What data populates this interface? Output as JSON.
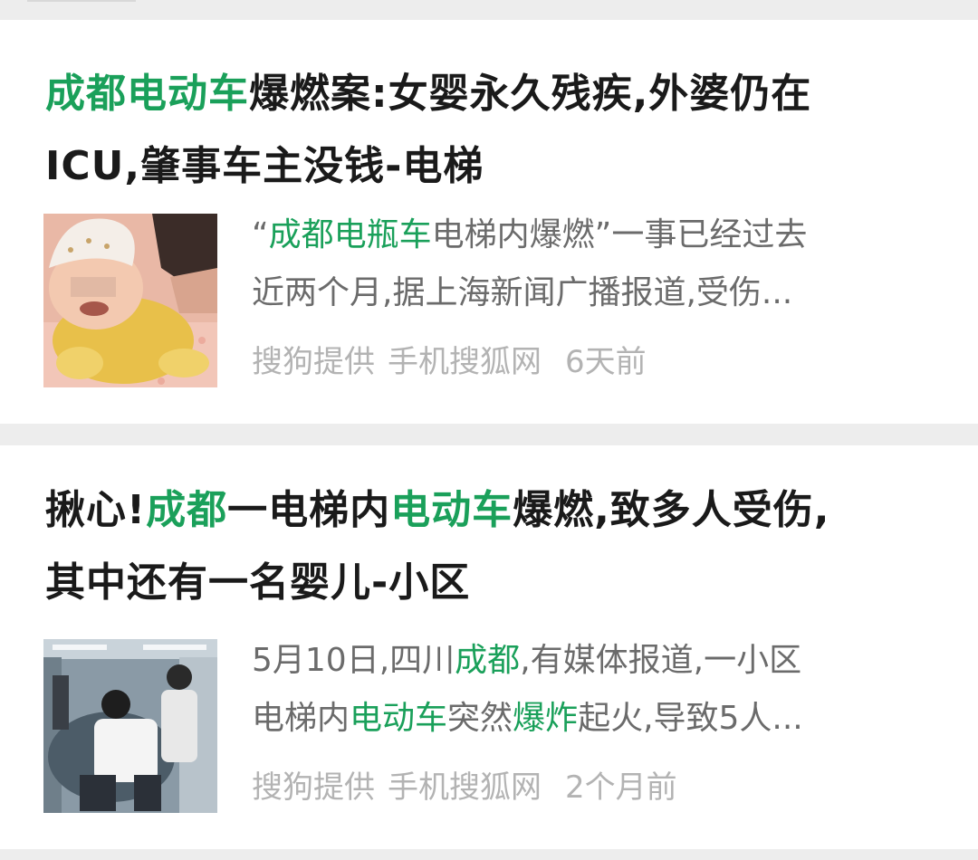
{
  "results": [
    {
      "title_parts": [
        {
          "text": "成都电动车",
          "hl": true
        },
        {
          "text": "爆燃案:女婴永久残疾,外婆仍在",
          "hl": false
        }
      ],
      "title_line2": "ICU,肇事车主没钱-电梯",
      "snippet_line1_parts": [
        {
          "text": "“",
          "hl": false
        },
        {
          "text": "成都电瓶车",
          "hl": true
        },
        {
          "text": "电梯内爆燃”一事已经过去",
          "hl": false
        }
      ],
      "snippet_line2": "近两个月,据上海新闻广播报道,受伤...",
      "provider": "搜狗提供",
      "source": "手机搜狐网",
      "time": "6天前",
      "thumb_icon": "baby-photo-thumbnail"
    },
    {
      "title_parts": [
        {
          "text": "揪心!",
          "hl": false
        },
        {
          "text": "成都",
          "hl": true
        },
        {
          "text": "一电梯内",
          "hl": false
        },
        {
          "text": "电动车",
          "hl": true
        },
        {
          "text": "爆燃,致多人受伤,",
          "hl": false
        }
      ],
      "title_line2": "其中还有一名婴儿-小区",
      "snippet_line1_parts": [
        {
          "text": "5月10日,四川",
          "hl": false
        },
        {
          "text": "成都",
          "hl": true
        },
        {
          "text": ",有媒体报道,一小区",
          "hl": false
        }
      ],
      "snippet_line2_parts": [
        {
          "text": "电梯内",
          "hl": false
        },
        {
          "text": "电动车",
          "hl": true
        },
        {
          "text": "突然",
          "hl": false
        },
        {
          "text": "爆炸",
          "hl": true
        },
        {
          "text": "起火,导致5人...",
          "hl": false
        }
      ],
      "provider": "搜狗提供",
      "source": "手机搜狐网",
      "time": "2个月前",
      "thumb_icon": "elevator-cctv-thumbnail"
    }
  ],
  "colors": {
    "highlight": "#1aa05a",
    "title": "#1a1a1a",
    "snippet": "#6b6b6b",
    "meta": "#b3b3b3",
    "background": "#ededed"
  }
}
